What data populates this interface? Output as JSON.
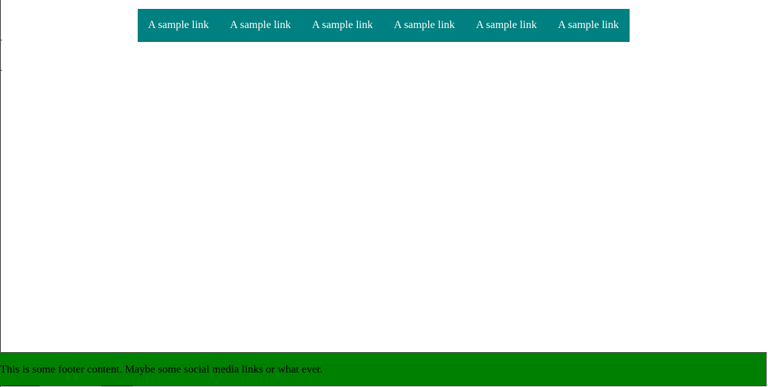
{
  "nav": {
    "links": [
      "A sample link",
      "A sample link",
      "A sample link",
      "A sample link",
      "A sample link",
      "A sample link"
    ]
  },
  "footer": {
    "text": "This is some footer content. Maybe some social media links or what ever."
  },
  "colors": {
    "nav_background": "#008080",
    "footer_background": "#008000",
    "link_text": "#ffffff"
  }
}
